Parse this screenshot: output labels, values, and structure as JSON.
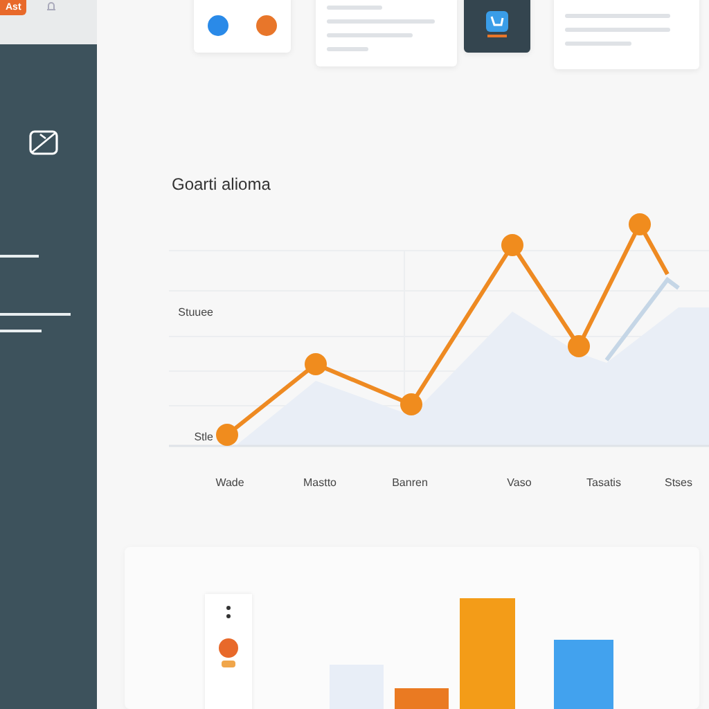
{
  "sidebar": {
    "badge": "Ast"
  },
  "chart": {
    "title": "Goarti alioma",
    "y_labels": [
      "Stuuee",
      "Stle"
    ],
    "x_labels": [
      "Wade",
      "Mastto",
      "Banren",
      "Vaso",
      "Tasatis",
      "Stses"
    ]
  }
}
